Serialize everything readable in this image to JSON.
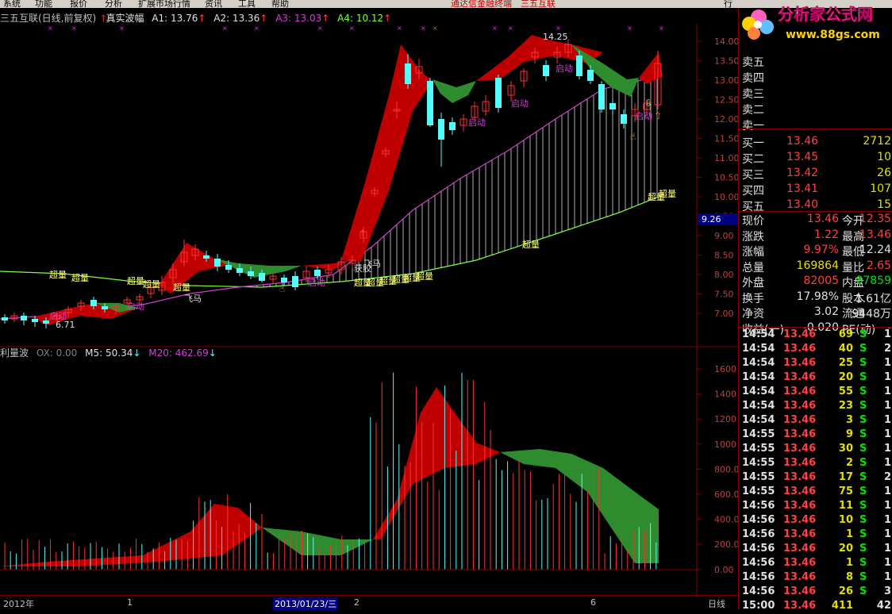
{
  "menu": {
    "items": [
      "系统",
      "功能",
      "报价",
      "分析",
      "扩展市场行情",
      "资讯",
      "工具",
      "帮助"
    ],
    "center_title": "通达信金融终端",
    "center_stock": "三五互联"
  },
  "main_header": {
    "title": "三五互联(日线,前复权)",
    "indicator": "真实波幅",
    "a1": "A1: 13.76",
    "a2": "A2: 13.36",
    "a3": "A3: 13.03",
    "a4": "A4: 10.12"
  },
  "vol_header": {
    "title": "利量波",
    "ox": "OX: 0.00",
    "m5": "M5: 50.34",
    "m20": "M20: 462.69"
  },
  "price_axis": [
    "14.00",
    "13.50",
    "13.00",
    "12.50",
    "12.00",
    "11.50",
    "11.00",
    "10.50",
    "10.00",
    "9.50",
    "9.00",
    "8.50",
    "8.00",
    "7.50",
    "7.00"
  ],
  "price_axis_marker": "9.26",
  "vol_axis": [
    "1600",
    "1400",
    "1200",
    "1000",
    "800.0",
    "600.0",
    "400.0",
    "200.0",
    "0.00"
  ],
  "annotations": {
    "high": "14.25",
    "low": "6.71",
    "labels": {
      "chaoliang": "超量",
      "qidong": "启动",
      "feima": "飞马",
      "huojiao": "获胶"
    }
  },
  "date_axis": {
    "year": "2012年",
    "m1": "1",
    "date": "2013/01/23/三",
    "m2": "2",
    "m6": "6",
    "period": "日线"
  },
  "logo": {
    "title": "分析家公式网",
    "url": "www.88gs.com"
  },
  "quote": {
    "top_partial": "行",
    "sell_labels": [
      "卖五",
      "卖四",
      "卖三",
      "卖二",
      "卖一"
    ],
    "buy": [
      {
        "label": "买一",
        "price": "13.46",
        "vol": "2712"
      },
      {
        "label": "买二",
        "price": "13.45",
        "vol": "10"
      },
      {
        "label": "买三",
        "price": "13.42",
        "vol": "26"
      },
      {
        "label": "买四",
        "price": "13.41",
        "vol": "107"
      },
      {
        "label": "买五",
        "price": "13.40",
        "vol": "15"
      }
    ],
    "stats": [
      {
        "l1": "现价",
        "v1": "13.46",
        "l2": "今开",
        "v2": "12.35",
        "c1": "#ff4040",
        "c2": "#ff4040"
      },
      {
        "l1": "涨跌",
        "v1": "1.22",
        "l2": "最高",
        "v2": "13.46",
        "c1": "#ff4040",
        "c2": "#ff4040"
      },
      {
        "l1": "涨幅",
        "v1": "9.97%",
        "l2": "最低",
        "v2": "12.24",
        "c1": "#ff4040",
        "c2": "#e0e0e0"
      },
      {
        "l1": "总量",
        "v1": "169864",
        "l2": "量比",
        "v2": "2.65",
        "c1": "#e0e000",
        "c2": "#ff4040"
      },
      {
        "l1": "外盘",
        "v1": "82005",
        "l2": "内盘",
        "v2": "87859",
        "c1": "#ff4040",
        "c2": "#00e000"
      },
      {
        "l1": "换手",
        "v1": "17.98%",
        "l2": "股本",
        "v2": "1.61亿",
        "c1": "#e0e0e0",
        "c2": "#e0e0e0"
      },
      {
        "l1": "净资",
        "v1": "3.02",
        "l2": "流通",
        "v2": "9448万",
        "c1": "#e0e0e0",
        "c2": "#e0e0e0"
      },
      {
        "l1": "收益(一)",
        "v1": "-0.020",
        "l2": "PE(动)",
        "v2": "-",
        "c1": "#e0e0e0",
        "c2": "#e0e0e0"
      }
    ],
    "ticks": [
      {
        "t": "14:54",
        "p": "13.46",
        "v": "69",
        "s": "S",
        "n": "1"
      },
      {
        "t": "14:54",
        "p": "13.46",
        "v": "40",
        "s": "S",
        "n": "2"
      },
      {
        "t": "14:54",
        "p": "13.46",
        "v": "25",
        "s": "S",
        "n": "1"
      },
      {
        "t": "14:54",
        "p": "13.46",
        "v": "20",
        "s": "S",
        "n": "1"
      },
      {
        "t": "14:54",
        "p": "13.46",
        "v": "55",
        "s": "S",
        "n": "1"
      },
      {
        "t": "14:54",
        "p": "13.46",
        "v": "23",
        "s": "S",
        "n": "1"
      },
      {
        "t": "14:54",
        "p": "13.46",
        "v": "3",
        "s": "S",
        "n": "1"
      },
      {
        "t": "14:55",
        "p": "13.46",
        "v": "9",
        "s": "S",
        "n": "1"
      },
      {
        "t": "14:55",
        "p": "13.46",
        "v": "30",
        "s": "S",
        "n": "1"
      },
      {
        "t": "14:55",
        "p": "13.46",
        "v": "2",
        "s": "S",
        "n": "1"
      },
      {
        "t": "14:55",
        "p": "13.46",
        "v": "17",
        "s": "S",
        "n": "2"
      },
      {
        "t": "14:55",
        "p": "13.46",
        "v": "75",
        "s": "S",
        "n": "1"
      },
      {
        "t": "14:56",
        "p": "13.46",
        "v": "11",
        "s": "S",
        "n": "1"
      },
      {
        "t": "14:56",
        "p": "13.46",
        "v": "10",
        "s": "S",
        "n": "1"
      },
      {
        "t": "14:56",
        "p": "13.46",
        "v": "1",
        "s": "S",
        "n": "1"
      },
      {
        "t": "14:56",
        "p": "13.46",
        "v": "20",
        "s": "S",
        "n": "1"
      },
      {
        "t": "14:56",
        "p": "13.46",
        "v": "1",
        "s": "S",
        "n": "1"
      },
      {
        "t": "14:56",
        "p": "13.46",
        "v": "8",
        "s": "S",
        "n": "1"
      },
      {
        "t": "14:56",
        "p": "13.46",
        "v": "26",
        "s": "S",
        "n": "3"
      },
      {
        "t": "15:00",
        "p": "13.46",
        "v": "411",
        "s": "",
        "n": "42"
      }
    ]
  },
  "colors": {
    "up": "#ff3030",
    "down": "#54fcfc",
    "green_band": "#2e8b2e",
    "red_band": "#c00000",
    "ma": "#d040d0",
    "line": "#80ff40"
  }
}
